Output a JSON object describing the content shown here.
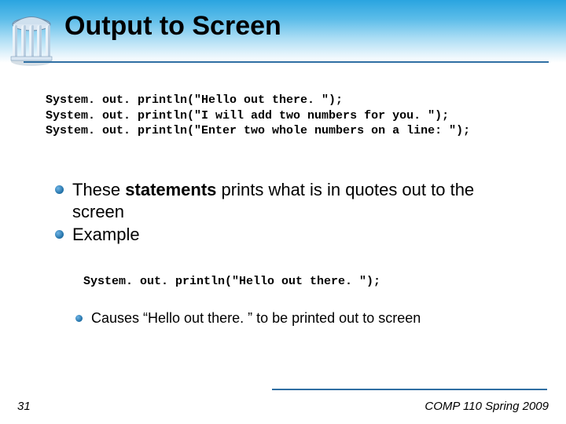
{
  "title": "Output to Screen",
  "code_lines": [
    "System. out. println(\"Hello out there. \");",
    "System. out. println(\"I will add two numbers for you. \");",
    "System. out. println(\"Enter two whole numbers on a line: \");"
  ],
  "bullet1_a": "These ",
  "bullet1_b": "statements",
  "bullet1_c": " prints what is in quotes out to the screen",
  "bullet2": "Example",
  "example_code": "System. out. println(\"Hello out there. \");",
  "sub_bullet": "Causes “Hello out there. ” to be printed out to screen",
  "page_number": "31",
  "course_label": "COMP 110 Spring 2009"
}
